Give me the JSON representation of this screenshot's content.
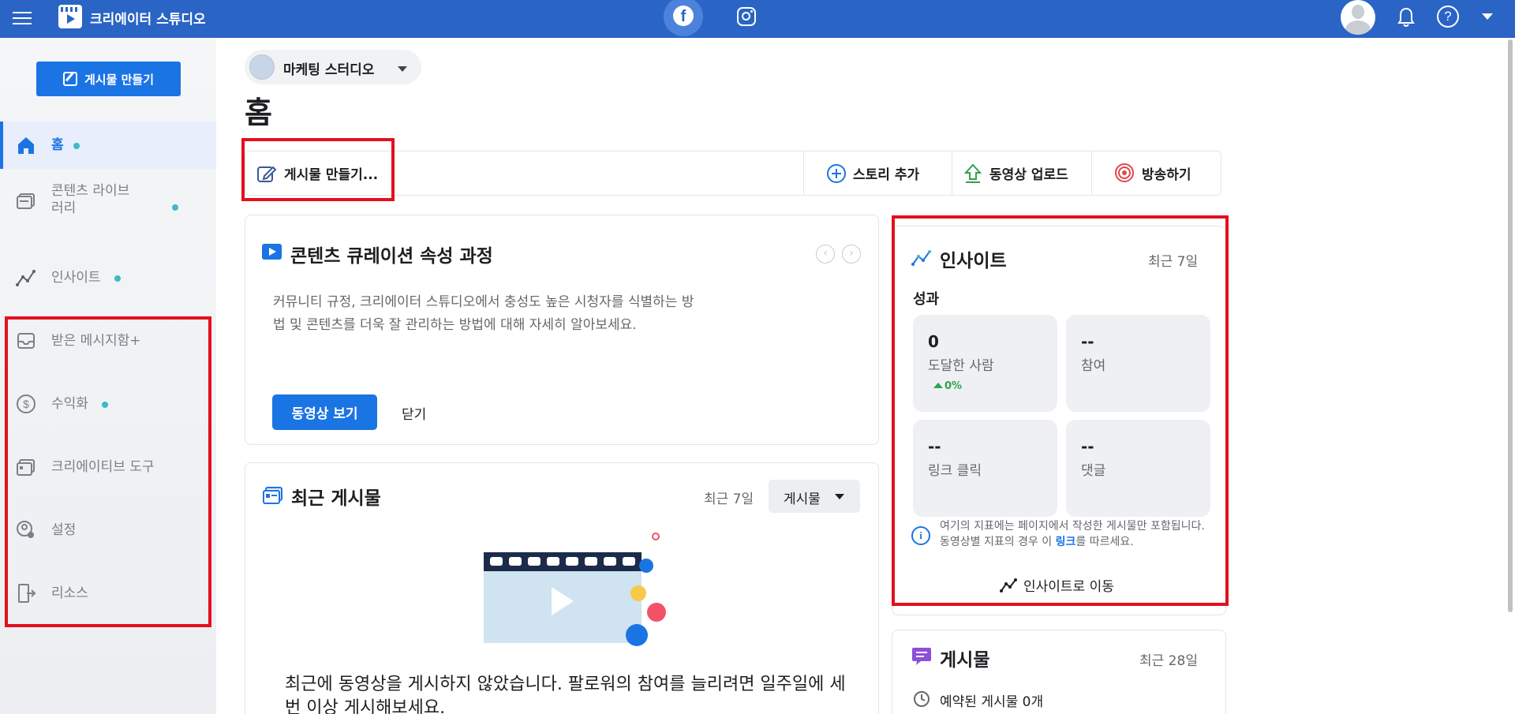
{
  "app": {
    "title": "크리에이터 스튜디오"
  },
  "sidebar": {
    "create_button": "게시물 만들기",
    "items": [
      {
        "label": "홈",
        "dot": true
      },
      {
        "label": "콘텐츠 라이브러리",
        "dot": true
      },
      {
        "label": "인사이트",
        "dot": true
      },
      {
        "label": "받은 메시지함+",
        "dot": false
      },
      {
        "label": "수익화",
        "dot": true
      },
      {
        "label": "크리에이티브 도구",
        "dot": false
      },
      {
        "label": "설정",
        "dot": false
      },
      {
        "label": "리소스",
        "dot": false
      }
    ]
  },
  "page_selector": {
    "name": "마케팅 스터디오"
  },
  "page_title": "홈",
  "action_bar": {
    "compose": "게시물 만들기...",
    "story": "스토리 추가",
    "upload": "동영상 업로드",
    "live": "방송하기"
  },
  "curation": {
    "title": "콘텐츠 큐레이션 속성 과정",
    "body": "커뮤니티 규정, 크리에이터 스튜디오에서 충성도 높은 시청자를 식별하는 방법 및 콘텐츠를 더욱 잘 관리하는 방법에 대해 자세히 알아보세요.",
    "watch_button": "동영상 보기",
    "close_button": "닫기"
  },
  "recent_posts": {
    "title": "최근 게시물",
    "period": "최근 7일",
    "filter": "게시물",
    "empty_text": "최근에 동영상을 게시하지 않았습니다. 팔로워의 참여를 늘리려면 일주일에 세 번 이상 게시해보세요."
  },
  "insights": {
    "title": "인사이트",
    "period": "최근 7일",
    "section": "성과",
    "metrics": [
      {
        "value": "0",
        "label": "도달한 사람",
        "delta": "0%"
      },
      {
        "value": "--",
        "label": "참여"
      },
      {
        "value": "--",
        "label": "링크 클릭"
      },
      {
        "value": "--",
        "label": "댓글"
      }
    ],
    "note_prefix": "여기의 지표에는 페이지에서 작성한 게시물만 포함됩니다. 동영상별 지표의 경우 이 ",
    "note_link": "링크",
    "note_suffix": "를 따르세요.",
    "goto": "인사이트로 이동"
  },
  "posts_card": {
    "title": "게시물",
    "period": "최근 28일",
    "scheduled": "예약된 게시물 0개"
  },
  "colors": {
    "brand": "#2a64c5",
    "primary": "#1b74e4",
    "highlight": "#e3101e",
    "dot": "#3fb8c7"
  }
}
